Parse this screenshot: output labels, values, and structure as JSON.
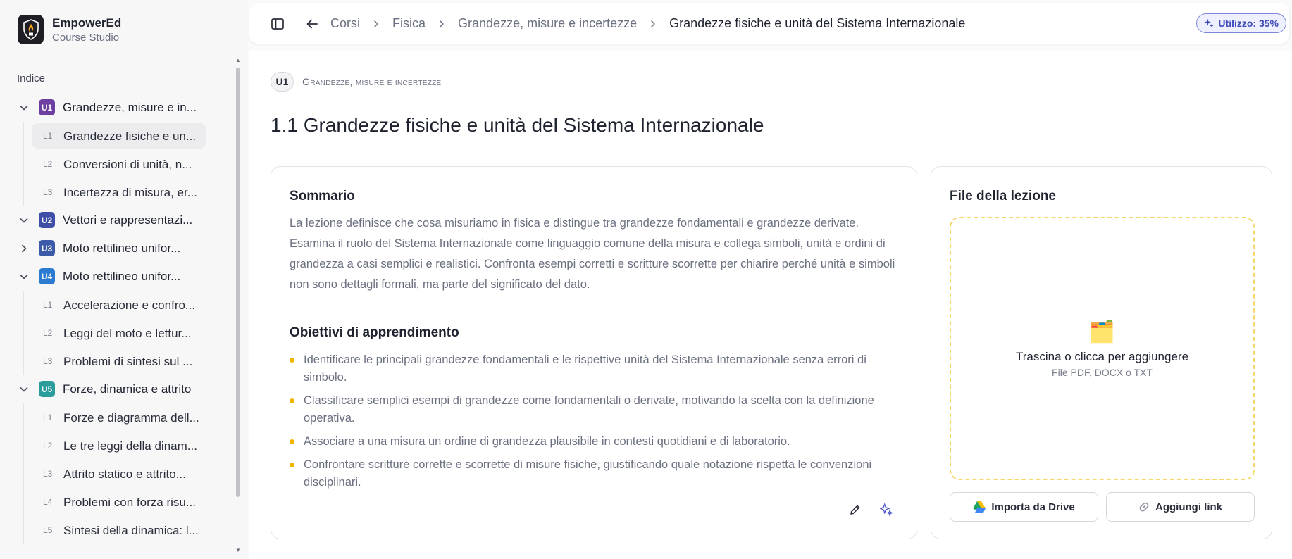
{
  "brand": {
    "name": "EmpowerEd",
    "subtitle": "Course Studio"
  },
  "sidebar": {
    "index_label": "Indice",
    "units": [
      {
        "code": "U1",
        "label": "Grandezze, misure e in...",
        "color": "#6c3fa0",
        "expanded": true,
        "lessons": [
          {
            "code": "L1",
            "label": "Grandezze fisiche e un...",
            "active": true
          },
          {
            "code": "L2",
            "label": "Conversioni di unità, n..."
          },
          {
            "code": "L3",
            "label": "Incertezza di misura, er..."
          }
        ]
      },
      {
        "code": "U2",
        "label": "Vettori e rappresentazi...",
        "color": "#3f4fa8",
        "expanded": true,
        "lessons": []
      },
      {
        "code": "U3",
        "label": "Moto rettilineo unifor...",
        "color": "#3b5aa8",
        "expanded": false,
        "lessons": []
      },
      {
        "code": "U4",
        "label": "Moto rettilineo unifor...",
        "color": "#2b7bd0",
        "expanded": true,
        "lessons": [
          {
            "code": "L1",
            "label": "Accelerazione e confro..."
          },
          {
            "code": "L2",
            "label": "Leggi del moto e lettur..."
          },
          {
            "code": "L3",
            "label": "Problemi di sintesi sul ..."
          }
        ]
      },
      {
        "code": "U5",
        "label": "Forze, dinamica e attrito",
        "color": "#2a9d9b",
        "expanded": true,
        "lessons": [
          {
            "code": "L1",
            "label": "Forze e diagramma dell..."
          },
          {
            "code": "L2",
            "label": "Le tre leggi della dinam..."
          },
          {
            "code": "L3",
            "label": "Attrito statico e attrito..."
          },
          {
            "code": "L4",
            "label": "Problemi con forza risu..."
          },
          {
            "code": "L5",
            "label": "Sintesi della dinamica: l..."
          }
        ]
      }
    ]
  },
  "breadcrumb": [
    "Corsi",
    "Fisica",
    "Grandezze, misure e incertezze",
    "Grandezze fisiche e unità del Sistema Internazionale"
  ],
  "usage": {
    "label": "Utilizzo: 35%",
    "value_percent": 35
  },
  "header": {
    "unit_code": "U1",
    "unit_title": "Grandezze, misure e incertezze",
    "lesson_title": "1.1 Grandezze fisiche e unità del Sistema Internazionale"
  },
  "summary": {
    "heading": "Sommario",
    "text": "La lezione definisce che cosa misuriamo in fisica e distingue tra grandezze fondamentali e grandezze derivate. Esamina il ruolo del Sistema Internazionale come linguaggio comune della misura e collega simboli, unità e ordini di grandezza a casi semplici e realistici. Confronta esempi corretti e scritture scorrette per chiarire perché unità e simboli non sono dettagli formali, ma parte del significato del dato."
  },
  "objectives": {
    "heading": "Obiettivi di apprendimento",
    "items": [
      "Identificare le principali grandezze fondamentali e le rispettive unità del Sistema Internazionale senza errori di simbolo.",
      "Classificare semplici esempi di grandezze come fondamentali o derivate, motivando la scelta con la definizione operativa.",
      "Associare a una misura un ordine di grandezza plausibile in contesti quotidiani e di laboratorio.",
      "Confrontare scritture corrette e scorrette di misure fisiche, giustificando quale notazione rispetta le convenzioni disciplinari."
    ]
  },
  "files": {
    "heading": "File della lezione",
    "drop_title": "Trascina o clicca per aggiungere",
    "drop_sub": "File PDF, DOCX o TXT",
    "drive_button": "Importa da Drive",
    "link_button": "Aggiungi link"
  }
}
